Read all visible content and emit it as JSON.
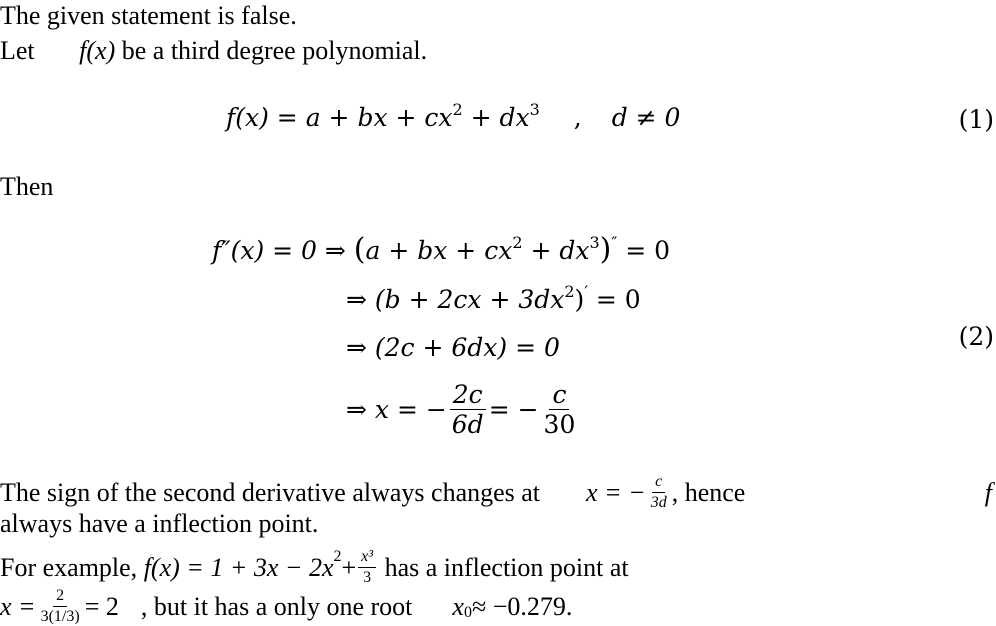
{
  "intro": {
    "line1": "The given statement is false.",
    "line2_prefix": "Let",
    "line2_math": "f(x)",
    "line2_suffix": "be a third degree polynomial."
  },
  "equation1": {
    "lhs": "f(x) = a + bx + cx",
    "exp2": "2",
    "mid": " + dx",
    "exp3": "3",
    "sep": ",",
    "condition": "d ≠ 0",
    "number": "(1)"
  },
  "then_label": "Then",
  "equation2": {
    "line1_lhs": "f″(x) = 0 ⇒ ",
    "line1_paren_open": "(",
    "line1_body": "a + bx + cx",
    "line1_exp2": "2",
    "line1_body2": " + dx",
    "line1_exp3": "3",
    "line1_paren_close": ")",
    "line1_prime": "″",
    "line1_rhs": " = 0",
    "line2_arrow": "⇒ ",
    "line2_body": "(b + 2cx + 3dx",
    "line2_exp": "2",
    "line2_close": ")",
    "line2_prime": "′",
    "line2_rhs": " = 0",
    "line3": "⇒ (2c + 6dx) = 0",
    "line4_prefix": "⇒ x = −",
    "line4_frac1_num": "2c",
    "line4_frac1_den": "6d",
    "line4_mid": " = −",
    "line4_frac2_num": "c",
    "line4_frac2_den": "30",
    "number": "(2)"
  },
  "conclusion": {
    "line1_text": "The sign of the second derivative always changes at",
    "line1_math_prefix": "x = −",
    "line1_frac_num": "c",
    "line1_frac_den": "3d",
    "line1_suffix": ", hence",
    "line1_f": "f",
    "line2": "always have a inflection point.",
    "example_prefix": "For example,",
    "example_math": "f(x) = 1 + 3x − 2x",
    "example_exp2": "2",
    "example_plus": " + ",
    "example_frac_num": "x³",
    "example_frac_den": "3",
    "example_suffix": "has a inflection point at",
    "last_x": "x = ",
    "last_frac_num": "2",
    "last_frac_den": "3(1/3)",
    "last_eq": " = 2",
    "last_text": ", but it has a only one root",
    "root_var": "x",
    "root_sub": "0",
    "root_value": " ≈ −0.279."
  }
}
